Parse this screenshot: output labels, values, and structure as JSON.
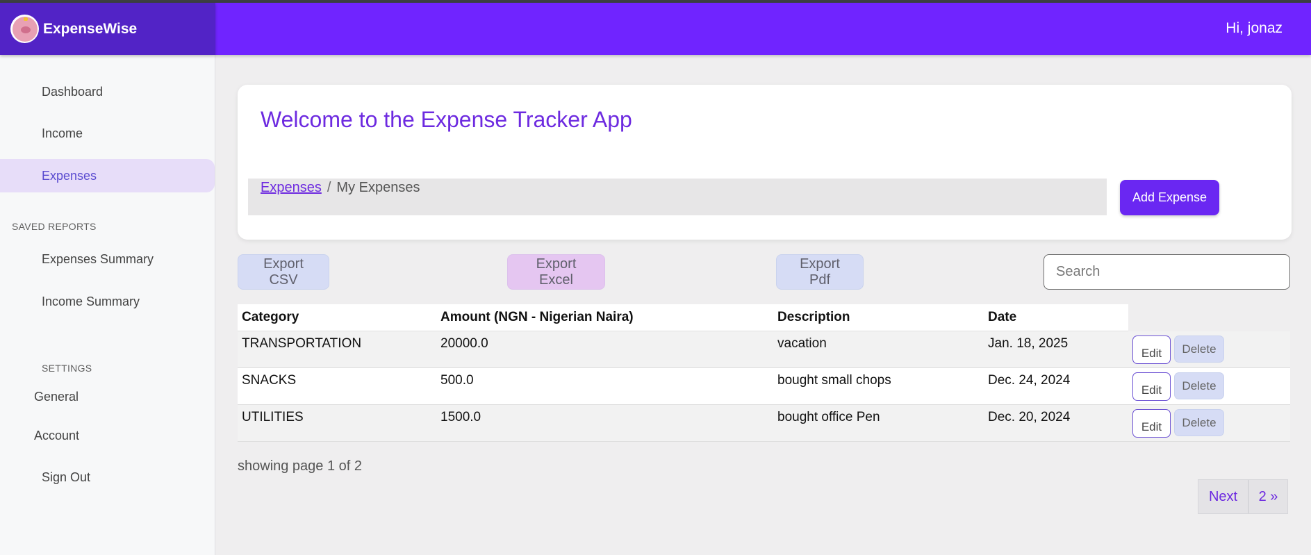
{
  "app": {
    "name": "ExpenseWise",
    "greeting": "Hi, jonaz"
  },
  "sidebar": {
    "items": [
      {
        "label": "Dashboard"
      },
      {
        "label": "Income"
      },
      {
        "label": "Expenses",
        "active": true
      }
    ],
    "saved_reports_label": "SAVED REPORTS",
    "reports": [
      {
        "label": "Expenses Summary"
      },
      {
        "label": "Income Summary"
      }
    ],
    "settings_label": "SETTINGS",
    "settings": [
      {
        "label": "General"
      },
      {
        "label": "Account"
      }
    ],
    "signout": "Sign Out"
  },
  "header": {
    "title": "Welcome to the Expense Tracker App"
  },
  "breadcrumb": {
    "link": "Expenses",
    "separator": "/",
    "current": "My Expenses"
  },
  "actions": {
    "add_expense": "Add Expense",
    "export_csv": "Export CSV",
    "export_excel": "Export Excel",
    "export_pdf": "Export Pdf",
    "search_placeholder": "Search"
  },
  "table": {
    "columns": [
      "Category",
      "Amount (NGN - Nigerian Naira)",
      "Description",
      "Date"
    ],
    "rows": [
      {
        "category": "TRANSPORTATION",
        "amount": "20000.0",
        "description": "vacation",
        "date": "Jan. 18, 2025"
      },
      {
        "category": "SNACKS",
        "amount": "500.0",
        "description": "bought small chops",
        "date": "Dec. 24, 2024"
      },
      {
        "category": "UTILITIES",
        "amount": "1500.0",
        "description": "bought office Pen",
        "date": "Dec. 20, 2024"
      }
    ],
    "edit_label": "Edit",
    "delete_label": "Delete"
  },
  "pagination": {
    "status": "showing page 1 of 2",
    "next": "Next",
    "last": "2 »"
  },
  "colors": {
    "topbar": "#7024ff",
    "brand": "#5223c6",
    "accent": "#6d2ae0",
    "active_nav_bg": "#e7ddf9"
  }
}
